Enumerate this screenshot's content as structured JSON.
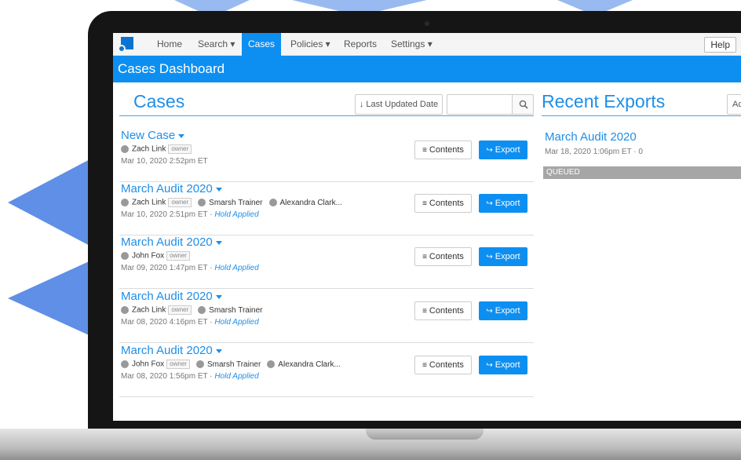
{
  "nav": {
    "items": [
      {
        "label": "Home"
      },
      {
        "label": "Search ▾"
      },
      {
        "label": "Cases"
      },
      {
        "label": "Policies ▾"
      },
      {
        "label": "Reports"
      },
      {
        "label": "Settings ▾"
      }
    ],
    "active_index": 2,
    "help_label": "Help"
  },
  "header": {
    "title": "Cases Dashboard"
  },
  "cases_panel": {
    "title": "Cases",
    "sort_label": "↓ Last Updated Date",
    "search_value": "",
    "search_icon": "search-icon"
  },
  "cases": [
    {
      "name": "New Case",
      "members": [
        {
          "name": "Zach Link",
          "role": "owner"
        }
      ],
      "date": "Mar 10, 2020 2:52pm ET",
      "hold": "",
      "contents_label": "Contents",
      "export_label": "Export"
    },
    {
      "name": "March Audit 2020",
      "members": [
        {
          "name": "Zach Link",
          "role": "owner"
        },
        {
          "name": "Smarsh Trainer",
          "role": ""
        },
        {
          "name": "Alexandra Clark...",
          "role": ""
        }
      ],
      "date": "Mar 10, 2020 2:51pm ET",
      "hold": "Hold Applied",
      "contents_label": "Contents",
      "export_label": "Export"
    },
    {
      "name": "March Audit 2020",
      "members": [
        {
          "name": "John Fox",
          "role": "owner"
        }
      ],
      "date": "Mar 09, 2020 1:47pm ET",
      "hold": "Hold Applied",
      "contents_label": "Contents",
      "export_label": "Export"
    },
    {
      "name": "March Audit 2020",
      "members": [
        {
          "name": "Zach Link",
          "role": "owner"
        },
        {
          "name": "Smarsh Trainer",
          "role": ""
        }
      ],
      "date": "Mar 08, 2020 4:16pm ET",
      "hold": "Hold Applied",
      "contents_label": "Contents",
      "export_label": "Export"
    },
    {
      "name": "March Audit 2020",
      "members": [
        {
          "name": "John Fox",
          "role": "owner"
        },
        {
          "name": "Smarsh Trainer",
          "role": ""
        },
        {
          "name": "Alexandra Clark...",
          "role": ""
        }
      ],
      "date": "Mar 08, 2020 1:56pm ET",
      "hold": "Hold Applied",
      "contents_label": "Contents",
      "export_label": "Export"
    }
  ],
  "exports_panel": {
    "title": "Recent Exports",
    "add_label": "Ac",
    "items": [
      {
        "name": "March Audit 2020",
        "meta": "Mar 18, 2020 1:06pm ET · 0",
        "status": "QUEUED"
      }
    ]
  },
  "colors": {
    "accent": "#0d8ff2",
    "link": "#1f8ee8",
    "status_queued": "#a6a6a6"
  }
}
